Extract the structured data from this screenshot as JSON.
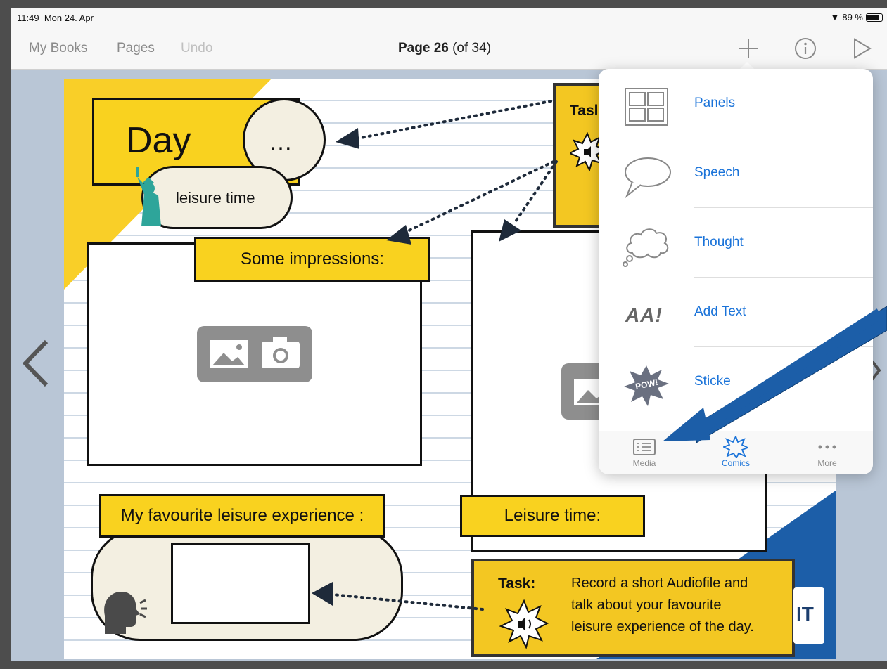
{
  "status": {
    "time": "11:49",
    "date": "Mon 24. Apr",
    "battery": "89 %"
  },
  "navbar": {
    "my_books": "My Books",
    "pages": "Pages",
    "undo": "Undo",
    "page_label": "Page 26",
    "page_of": "(of 34)"
  },
  "page": {
    "title_day": "Day",
    "title_dots": "…",
    "leisure_bubble": "leisure time",
    "impressions_label": "Some impressions:",
    "favourite_label": "My favourite leisure experience :",
    "leisure_time_label": "Leisure time:",
    "task_top_label": "Tasl",
    "task_bottom": {
      "label": "Task:",
      "text_lines": [
        "Record a short Audiofile and",
        "talk about your favourite",
        "leisure experience of the day."
      ]
    },
    "logo_text": "IT"
  },
  "popover": {
    "items": [
      {
        "label": "Panels",
        "icon": "panels-icon"
      },
      {
        "label": "Speech",
        "icon": "speech-bubble-icon"
      },
      {
        "label": "Thought",
        "icon": "thought-bubble-icon"
      },
      {
        "label": "Add Text",
        "icon": "add-text-icon",
        "icon_text": "AA!"
      },
      {
        "label": "Sticke",
        "icon": "sticker-icon",
        "icon_text": "POW!"
      }
    ],
    "tabs": [
      {
        "label": "Media",
        "icon": "media-icon"
      },
      {
        "label": "Comics",
        "icon": "comics-star-icon"
      },
      {
        "label": "More",
        "icon": "more-icon"
      }
    ]
  },
  "colors": {
    "accent_blue": "#1a73d9",
    "comic_yellow": "#f9d21f",
    "annotation_arrow": "#1c5ea8"
  }
}
